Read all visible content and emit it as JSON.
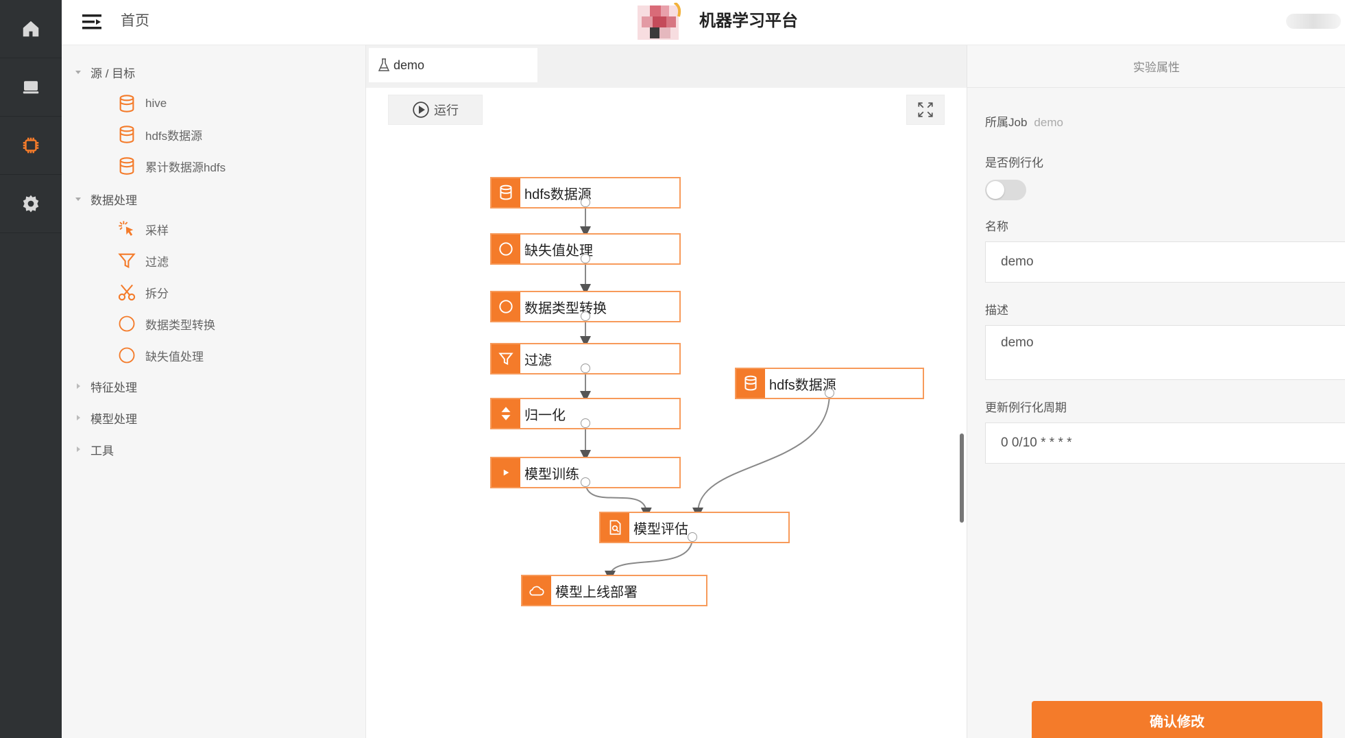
{
  "header": {
    "breadcrumb": "首页",
    "app_title": "机器学习平台"
  },
  "rail": {
    "items": [
      {
        "icon": "home-icon"
      },
      {
        "icon": "monitor-icon"
      },
      {
        "icon": "chip-icon",
        "active": true
      },
      {
        "icon": "gear-icon"
      }
    ],
    "active_color": "#f47b2a"
  },
  "tree": {
    "groups": [
      {
        "label": "源 / 目标",
        "expanded": true,
        "items": [
          {
            "label": "hive",
            "icon": "database-icon"
          },
          {
            "label": "hdfs数据源",
            "icon": "database-icon"
          },
          {
            "label": "累计数据源hdfs",
            "icon": "database-icon"
          }
        ]
      },
      {
        "label": "数据处理",
        "expanded": true,
        "items": [
          {
            "label": "采样",
            "icon": "cursor-click-icon"
          },
          {
            "label": "过滤",
            "icon": "filter-icon"
          },
          {
            "label": "拆分",
            "icon": "scissors-icon"
          },
          {
            "label": "数据类型转换",
            "icon": "circle-icon"
          },
          {
            "label": "缺失值处理",
            "icon": "circle-icon"
          }
        ]
      },
      {
        "label": "特征处理",
        "expanded": false
      },
      {
        "label": "模型处理",
        "expanded": false
      },
      {
        "label": "工具",
        "expanded": false
      }
    ]
  },
  "canvas": {
    "tab_label": "demo",
    "run_label": "运行",
    "nodes": [
      {
        "label": "hdfs数据源",
        "icon": "database-icon"
      },
      {
        "label": "缺失值处理",
        "icon": "circle-icon"
      },
      {
        "label": "数据类型转换",
        "icon": "circle-icon"
      },
      {
        "label": "过滤",
        "icon": "filter-icon"
      },
      {
        "label": "hdfs数据源",
        "icon": "database-icon"
      },
      {
        "label": "归一化",
        "icon": "normalize-icon"
      },
      {
        "label": "模型训练",
        "icon": "play-icon"
      },
      {
        "label": "模型评估",
        "icon": "evaluate-icon"
      },
      {
        "label": "模型上线部署",
        "icon": "cloud-icon"
      }
    ]
  },
  "props": {
    "title": "实验属性",
    "job_label": "所属Job",
    "job_value": "demo",
    "routine_label": "是否例行化",
    "routine_on": false,
    "name_label": "名称",
    "name_value": "demo",
    "desc_label": "描述",
    "desc_value": "demo",
    "period_label": "更新例行化周期",
    "period_value": "0 0/10 * * * *",
    "confirm_label": "确认修改"
  },
  "colors": {
    "accent": "#f47b2a",
    "node_border": "#f79a5a",
    "rail_bg": "#2f3234"
  }
}
